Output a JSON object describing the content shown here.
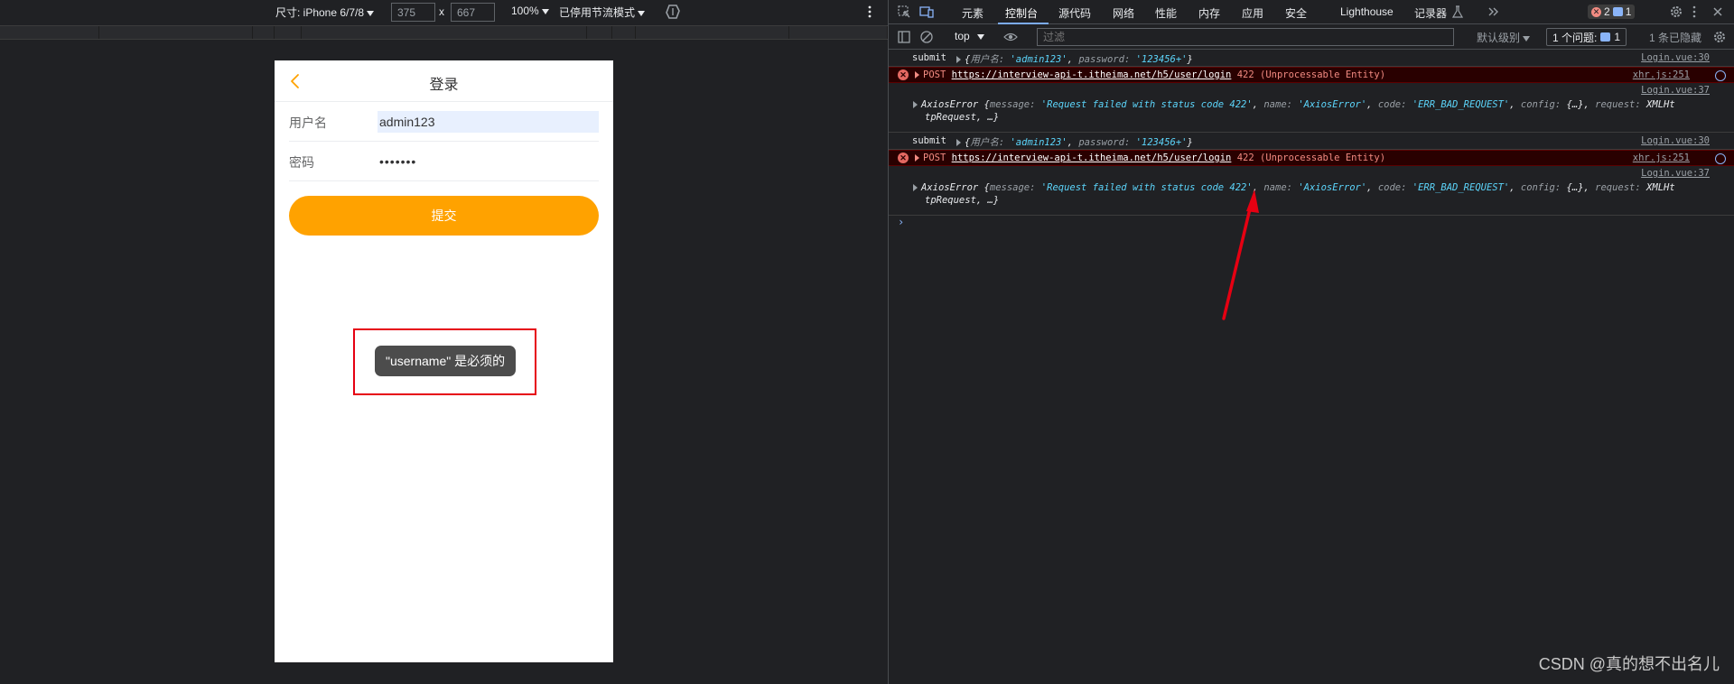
{
  "emulation": {
    "dimensions_label": "尺寸: iPhone 6/7/8",
    "width_value": "375",
    "height_value": "667",
    "times": "x",
    "zoom": "100%",
    "throttle": "已停用节流模式"
  },
  "phone": {
    "nav_title": "登录",
    "username_label": "用户名",
    "username_value": "admin123",
    "password_label": "密码",
    "password_value": "•••••••",
    "submit_label": "提交",
    "toast": "\"username\" 是必须的",
    "accent_color": "#ffa200"
  },
  "devtools": {
    "tabs": [
      "元素",
      "控制台",
      "源代码",
      "网络",
      "性能",
      "内存",
      "应用",
      "安全",
      "Lighthouse",
      "记录器"
    ],
    "active_tab": "控制台",
    "error_count": "2",
    "message_count": "1",
    "context": "top",
    "filter_placeholder": "过滤",
    "level": "默认级别",
    "issues": "1 个问题:",
    "issues_count": "1",
    "hidden": "1 条已隐藏"
  },
  "console": {
    "rows": [
      {
        "type": "log",
        "label": "submit",
        "obj_open": "{",
        "k1": "用户名",
        "v1": "'admin123'",
        "k2": "password",
        "v2": "'123456+'",
        "obj_close": "}",
        "src": "Login.vue:30"
      },
      {
        "type": "error",
        "method": "POST",
        "url": "https://interview-api-t.itheima.net/h5/user/login",
        "status": "422 (Unprocessable Entity)",
        "src": "xhr.js:251"
      },
      {
        "type": "axios",
        "src": "Login.vue:37",
        "name": "AxiosError",
        "message_key": "message",
        "message_val": "'Request failed with status code 422'",
        "name_key": "name",
        "name_val": "'AxiosError'",
        "code_key": "code",
        "code_val": "'ERR_BAD_REQUEST'",
        "config_key": "config",
        "config_val": "{…}",
        "request_key": "request",
        "request_val1": "XMLHt",
        "request_val2": "tpRequest, …}"
      },
      {
        "type": "log",
        "label": "submit",
        "obj_open": "{",
        "k1": "用户名",
        "v1": "'admin123'",
        "k2": "password",
        "v2": "'123456+'",
        "obj_close": "}",
        "src": "Login.vue:30"
      },
      {
        "type": "error",
        "method": "POST",
        "url": "https://interview-api-t.itheima.net/h5/user/login",
        "status": "422 (Unprocessable Entity)",
        "src": "xhr.js:251"
      },
      {
        "type": "axios",
        "src": "Login.vue:37",
        "name": "AxiosError",
        "message_key": "message",
        "message_val": "'Request failed with status code 422'",
        "name_key": "name",
        "name_val": "'AxiosError'",
        "code_key": "code",
        "code_val": "'ERR_BAD_REQUEST'",
        "config_key": "config",
        "config_val": "{…}",
        "request_key": "request",
        "request_val1": "XMLHt",
        "request_val2": "tpRequest, …}"
      }
    ],
    "prompt": "›"
  },
  "watermark": "CSDN @真的想不出名儿",
  "annotation_color": "#e60012"
}
